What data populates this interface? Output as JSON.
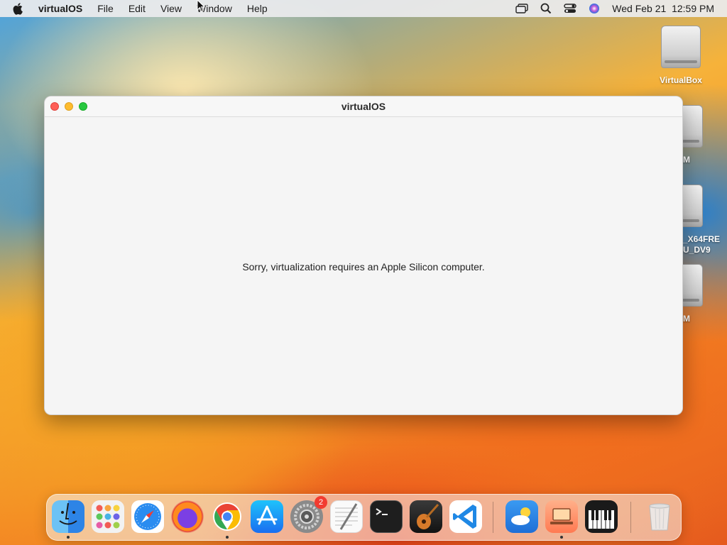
{
  "menubar": {
    "app_name": "virtualOS",
    "menus": [
      "File",
      "Edit",
      "View",
      "Window",
      "Help"
    ],
    "clock": "Wed Feb 21  12:59 PM",
    "status_icons": [
      "screen-mirroring-icon",
      "search-icon",
      "control-center-icon",
      "siri-icon"
    ]
  },
  "desktop": {
    "icons": [
      {
        "label": "VirtualBox",
        "icon": "drive-icon"
      },
      {
        "label": "M",
        "icon": "drive-icon"
      },
      {
        "label": "_X64FRE\nU_DV9",
        "icon": "drive-icon"
      },
      {
        "label": "M",
        "icon": "drive-icon"
      }
    ]
  },
  "window": {
    "title": "virtualOS",
    "message": "Sorry, virtualization requires an Apple Silicon computer."
  },
  "dock": {
    "items": [
      {
        "name": "Finder",
        "icon": "finder-icon",
        "running": true
      },
      {
        "name": "Launchpad",
        "icon": "launchpad-icon",
        "running": false
      },
      {
        "name": "Safari",
        "icon": "safari-icon",
        "running": false
      },
      {
        "name": "Firefox",
        "icon": "firefox-icon",
        "running": false
      },
      {
        "name": "Chrome",
        "icon": "chrome-icon",
        "running": true
      },
      {
        "name": "App Store",
        "icon": "app-store-icon",
        "running": false
      },
      {
        "name": "System Settings",
        "icon": "system-settings-icon",
        "running": false,
        "badge": "2"
      },
      {
        "name": "TextEdit",
        "icon": "textedit-icon",
        "running": false
      },
      {
        "name": "Terminal",
        "icon": "terminal-icon",
        "running": false
      },
      {
        "name": "GarageBand",
        "icon": "garageband-icon",
        "running": false
      },
      {
        "name": "Visual Studio Code",
        "icon": "vscode-icon",
        "running": false
      },
      {
        "name": "Weather",
        "icon": "weather-icon",
        "running": false
      },
      {
        "name": "virtualOS",
        "icon": "virtualos-icon",
        "running": true
      },
      {
        "name": "Piano",
        "icon": "piano-icon",
        "running": false
      },
      {
        "name": "Trash",
        "icon": "trash-icon",
        "running": false
      }
    ]
  },
  "colors": {
    "close": "#fe5f57",
    "minimize": "#febc2e",
    "maximize": "#28c840",
    "badge": "#f23b30"
  }
}
